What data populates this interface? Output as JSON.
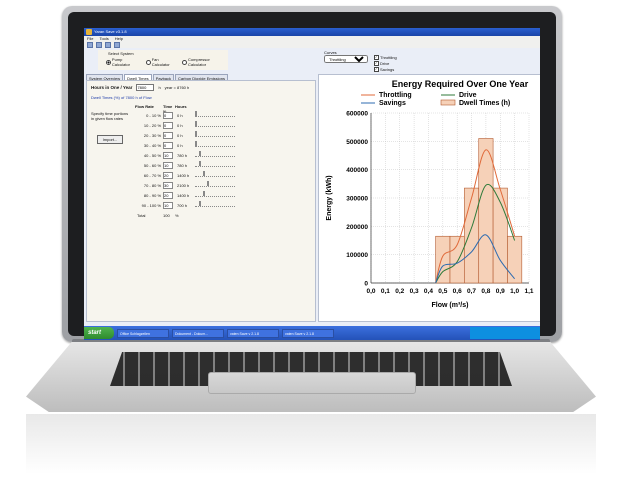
{
  "app": {
    "title": "Yaran Save v3.1.8",
    "menus": [
      "File",
      "Tools",
      "Help"
    ]
  },
  "system": {
    "label": "Select System",
    "options": [
      "Pump Calculator",
      "Fan Calculator",
      "Compressor Calculator"
    ],
    "selected": "Pump Calculator"
  },
  "curves": {
    "label": "Curves",
    "selected": "Throttling",
    "checkboxes": [
      {
        "label": "Throttling",
        "checked": true
      },
      {
        "label": "Drive",
        "checked": true
      },
      {
        "label": "Savings",
        "checked": true
      }
    ]
  },
  "tabs": [
    "System Overview",
    "Dwell Times",
    "Payback",
    "Carbon Dioxide Emissions"
  ],
  "active_tab": "Dwell Times",
  "hours": {
    "label": "Hours in One / Year",
    "value": "7800",
    "unit": "h",
    "note": "year = 8760 h"
  },
  "dwell": {
    "title": "Dwell Times (%) of 7800 h of Flow",
    "side_note": "Specify time portions in given flow rates",
    "import_label": "Import...",
    "headers": [
      "Flow Rate",
      "Time %",
      "Hours"
    ],
    "rows": [
      {
        "rate": "0 - 10 %",
        "time": "0",
        "hours": "0 h"
      },
      {
        "rate": "10 - 20 %",
        "time": "0",
        "hours": "0 h"
      },
      {
        "rate": "20 - 30 %",
        "time": "0",
        "hours": "0 h"
      },
      {
        "rate": "30 - 40 %",
        "time": "0",
        "hours": "0 h"
      },
      {
        "rate": "40 - 50 %",
        "time": "10",
        "hours": "780 h"
      },
      {
        "rate": "50 - 60 %",
        "time": "10",
        "hours": "780 h"
      },
      {
        "rate": "60 - 70 %",
        "time": "20",
        "hours": "1400 h"
      },
      {
        "rate": "70 - 80 %",
        "time": "30",
        "hours": "2100 h"
      },
      {
        "rate": "80 - 90 %",
        "time": "20",
        "hours": "1400 h"
      },
      {
        "rate": "90 - 100 %",
        "time": "10",
        "hours": "700 h"
      }
    ],
    "total_label": "Total",
    "total_value": "100",
    "total_unit": "%"
  },
  "taskbar": {
    "start": "start",
    "items": [
      "Office Schlagzeilen",
      "Dokument - Dokum...",
      "vaten Save v 2.1.8",
      "vaten Save v 2.1.8"
    ]
  },
  "chart_data": {
    "type": "line",
    "title": "Energy Required Over One Year",
    "xlabel": "Flow (m³/s)",
    "ylabel": "Energy (kWh)",
    "xlim": [
      0.0,
      1.1
    ],
    "ylim": [
      0,
      600000
    ],
    "x_ticks": [
      "0,0",
      "0,1",
      "0,2",
      "0,3",
      "0,4",
      "0,5",
      "0,6",
      "0,7",
      "0,8",
      "0,9",
      "1,0",
      "1,1"
    ],
    "y_ticks": [
      "0",
      "100000",
      "200000",
      "300000",
      "400000",
      "500000",
      "600000"
    ],
    "legend": [
      "Throttling",
      "Drive",
      "Savings",
      "Dwell Times (h)"
    ],
    "colors": {
      "throttling": "#e06a3a",
      "drive": "#2f7a3a",
      "savings": "#2d6bb0",
      "bars_fill": "#f6d1b8",
      "bars_stroke": "#b35a30"
    },
    "bars": {
      "name": "Dwell Times (h)",
      "x": [
        0.5,
        0.6,
        0.7,
        0.8,
        0.9,
        1.0
      ],
      "values": [
        165000,
        165000,
        335000,
        510000,
        335000,
        165000
      ]
    },
    "series": [
      {
        "name": "Throttling",
        "x": [
          0.45,
          0.5,
          0.6,
          0.7,
          0.8,
          0.9,
          1.0
        ],
        "values": [
          0,
          95000,
          135000,
          300000,
          470000,
          330000,
          165000
        ]
      },
      {
        "name": "Drive",
        "x": [
          0.45,
          0.5,
          0.6,
          0.7,
          0.8,
          0.9,
          1.0
        ],
        "values": [
          0,
          40000,
          75000,
          195000,
          345000,
          285000,
          150000
        ]
      },
      {
        "name": "Savings",
        "x": [
          0.45,
          0.5,
          0.6,
          0.7,
          0.8,
          0.9,
          1.0
        ],
        "values": [
          0,
          60000,
          70000,
          110000,
          170000,
          80000,
          15000
        ]
      }
    ],
    "grid": true,
    "legend_position": "top"
  }
}
